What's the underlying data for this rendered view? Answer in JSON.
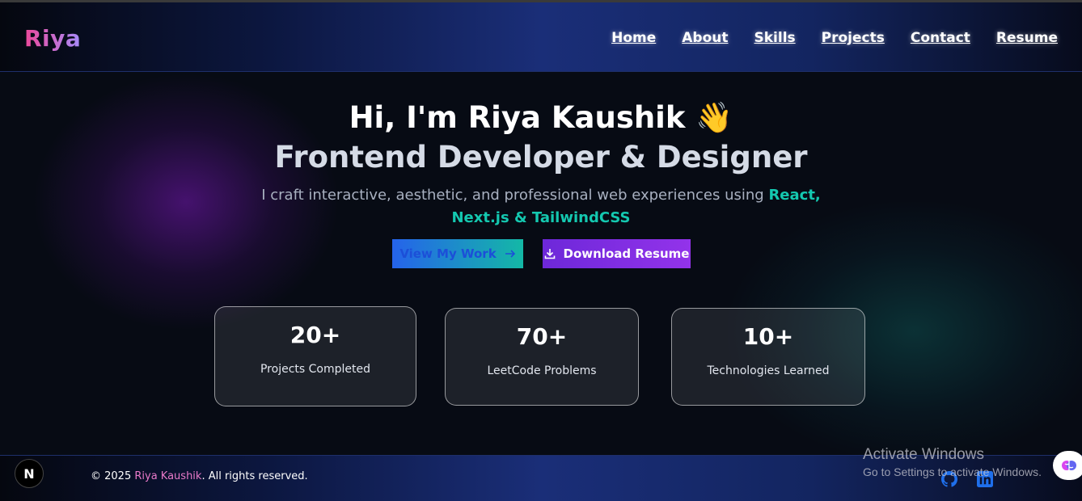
{
  "header": {
    "logo": "Riya",
    "nav": [
      "Home",
      "About",
      "Skills",
      "Projects",
      "Contact",
      "Resume"
    ]
  },
  "hero": {
    "greeting": "Hi, I'm Riya Kaushik 👋",
    "role": "Frontend Developer & Designer",
    "intro": "I craft interactive, aesthetic, and professional web experiences using ",
    "tech": "React, Next.js & TailwindCSS",
    "primary_button": "View My Work",
    "secondary_button": "Download Resume"
  },
  "stats": [
    {
      "value": "20+",
      "label": "Projects Completed"
    },
    {
      "value": "70+",
      "label": "LeetCode Problems"
    },
    {
      "value": "10+",
      "label": "Technologies Learned"
    }
  ],
  "footer": {
    "badge": "N",
    "copyright_prefix": "© 2025 ",
    "name": "Riya Kaushik",
    "copyright_suffix": ". All rights reserved."
  },
  "watermark": {
    "title": "Activate Windows",
    "subtitle": "Go to Settings to activate Windows."
  },
  "icons": {
    "github": "github-icon",
    "linkedin": "linkedin-icon",
    "arrow": "arrow-right-icon",
    "download": "download-icon",
    "assistant": "brain-icon"
  },
  "colors": {
    "accent_teal": "#14c8b0",
    "accent_pink": "#e879c9",
    "btn_blue": "#2563eb",
    "btn_purple": "#9333ea"
  }
}
